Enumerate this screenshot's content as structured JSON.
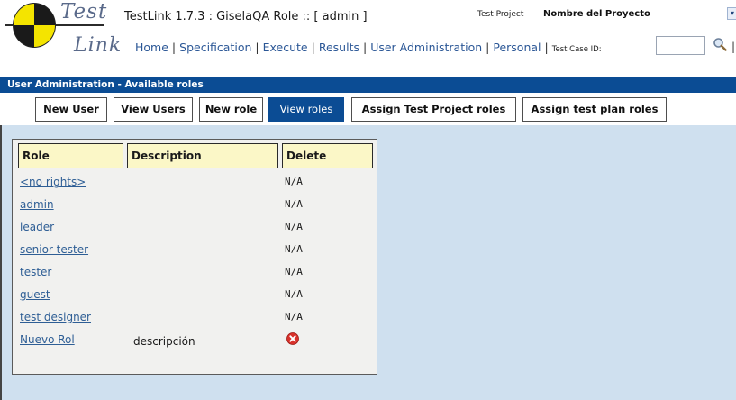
{
  "header": {
    "logo_test": "Test",
    "logo_link": "Link",
    "app_title": "TestLink 1.7.3 : GiselaQA Role :: [ admin ]",
    "project_label": "Test Project",
    "project_name": "Nombre del Proyecto",
    "nav": {
      "home": "Home",
      "specification": "Specification",
      "execute": "Execute",
      "results": "Results",
      "user_administration": "User Administration",
      "personal": "Personal",
      "test_case_id_label": "Test Case ID:",
      "test_case_id_value": ""
    }
  },
  "titlebar": "User Administration - Available roles",
  "tabs": [
    {
      "label": "New User"
    },
    {
      "label": "View Users"
    },
    {
      "label": "New role"
    },
    {
      "label": "View roles"
    },
    {
      "label": "Assign Test Project roles"
    },
    {
      "label": "Assign test plan roles"
    }
  ],
  "table": {
    "headers": {
      "role": "Role",
      "description": "Description",
      "delete": "Delete"
    },
    "rows": [
      {
        "role": "<no rights>",
        "description": "",
        "delete": "N/A"
      },
      {
        "role": "admin",
        "description": "",
        "delete": "N/A"
      },
      {
        "role": "leader",
        "description": "",
        "delete": "N/A"
      },
      {
        "role": "senior tester",
        "description": "",
        "delete": "N/A"
      },
      {
        "role": "tester",
        "description": "",
        "delete": "N/A"
      },
      {
        "role": "guest",
        "description": "",
        "delete": "N/A"
      },
      {
        "role": "test designer",
        "description": "",
        "delete": "N/A"
      },
      {
        "role": "Nuevo Rol",
        "description": "descripción",
        "delete": "delete-icon"
      }
    ]
  },
  "colors": {
    "brand_blue": "#0b4c94",
    "link_blue": "#2e5e95",
    "content_bg": "#cfe0ef",
    "header_cell": "#fbf7c7"
  }
}
